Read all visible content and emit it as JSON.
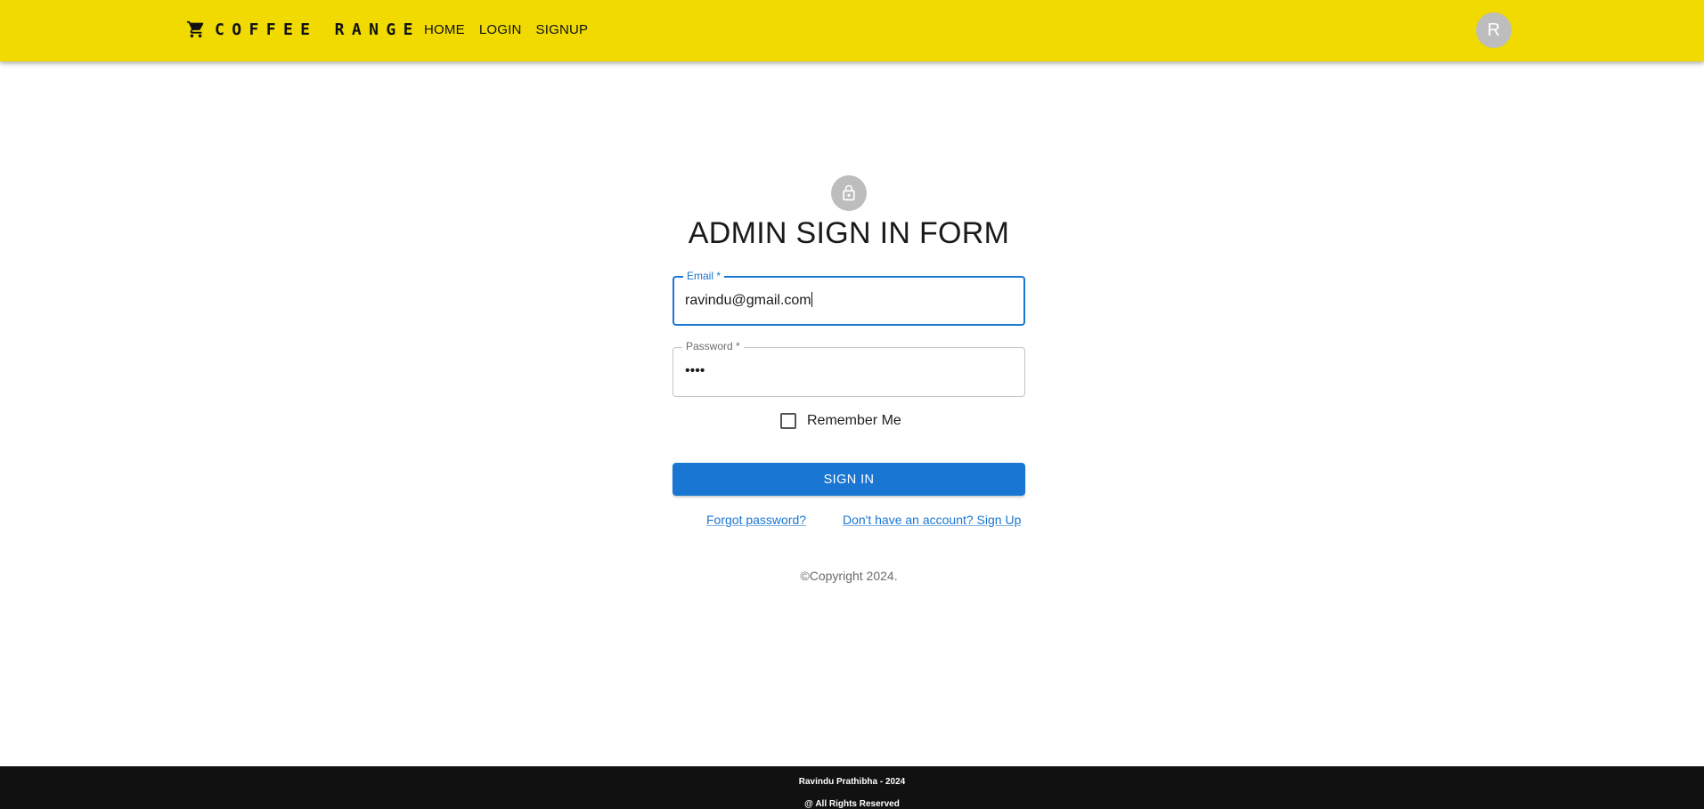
{
  "header": {
    "brand": "COFFEE RANGE",
    "brand_icon": "shopping-cart-icon",
    "nav": [
      "HOME",
      "LOGIN",
      "SIGNUP"
    ],
    "avatar_initial": "R",
    "bar_color": "#f0da00"
  },
  "form": {
    "icon": "lock-icon",
    "title": "ADMIN SIGN IN FORM",
    "email": {
      "label": "Email *",
      "value": "ravindu@gmail.com"
    },
    "password": {
      "label": "Password *",
      "value": "••••"
    },
    "remember_label": "Remember Me",
    "remember_checked": false,
    "submit_label": "SIGN IN",
    "forgot_link": "Forgot password?",
    "signup_link": "Don't have an account? Sign Up",
    "copyright": "©Copyright 2024.",
    "accent_color": "#1976d2"
  },
  "footer": {
    "line1": "Ravindu Prathibha - 2024",
    "line2": "@ All Rights Reserved"
  }
}
